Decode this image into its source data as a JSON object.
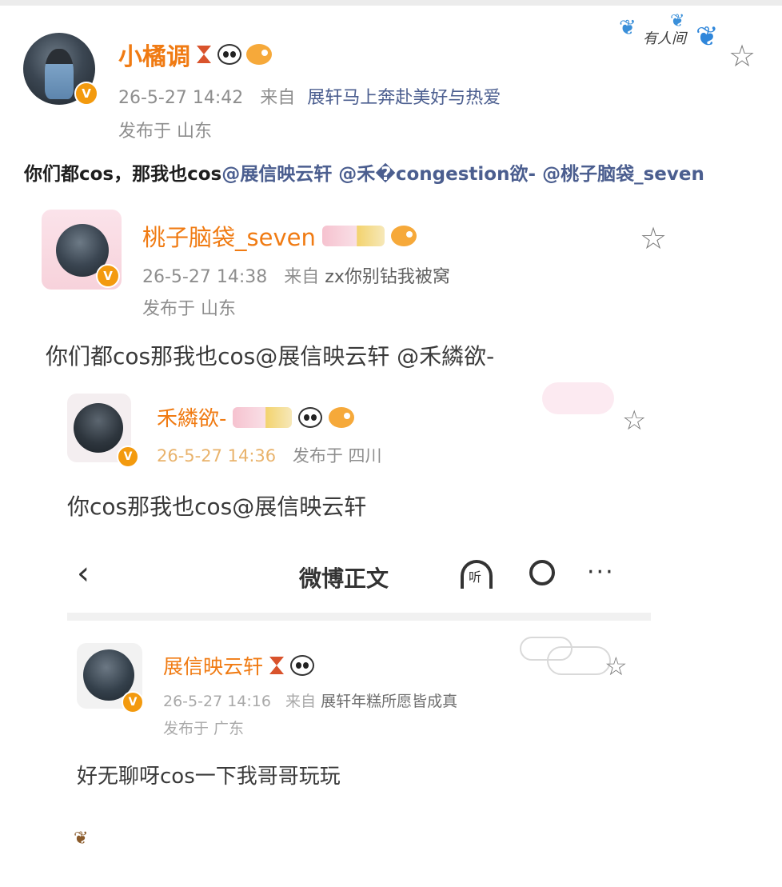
{
  "post": {
    "author": "小橘调",
    "time": "26-5-27 14:42",
    "from_label": "来自",
    "source": "展轩马上奔赴美好与热爱",
    "location": "发布于 山东",
    "text_prefix": "你们都cos，那我也cos",
    "mentions": [
      "@展信映云轩",
      "@禾�congestion欲-",
      "@桃子脑袋_seven"
    ],
    "watermark": "有人间"
  },
  "repost1": {
    "author": "桃子脑袋_seven",
    "time": "26-5-27 14:38",
    "from_label": "来自",
    "source": "zx你别钻我被窝",
    "location": "发布于 山东",
    "text": "你们都cos那我也cos@展信映云轩 @禾繗欲-"
  },
  "repost2": {
    "author": "禾繗欲-",
    "time": "26-5-27 14:36",
    "location": "发布于 四川",
    "text": "你cos那我也cos@展信映云轩"
  },
  "navbar": {
    "back_icon": "back-arrow-icon",
    "title": "微博正文",
    "listen_icon": "headphone-icon",
    "listen_label": "听",
    "search_icon": "search-icon",
    "more": "···"
  },
  "repost3": {
    "author": "展信映云轩",
    "time": "26-5-27 14:16",
    "from_label": "来自",
    "source": "展轩年糕所愿皆成真",
    "location": "发布于 广东",
    "text": "好无聊呀cos一下我哥哥玩玩"
  },
  "colors": {
    "name": "#f07b13",
    "link": "#4b5e8f",
    "meta": "#8e8e8e",
    "verified": "#f39a0e"
  },
  "verified_badge": "V",
  "star_icon": "☆"
}
